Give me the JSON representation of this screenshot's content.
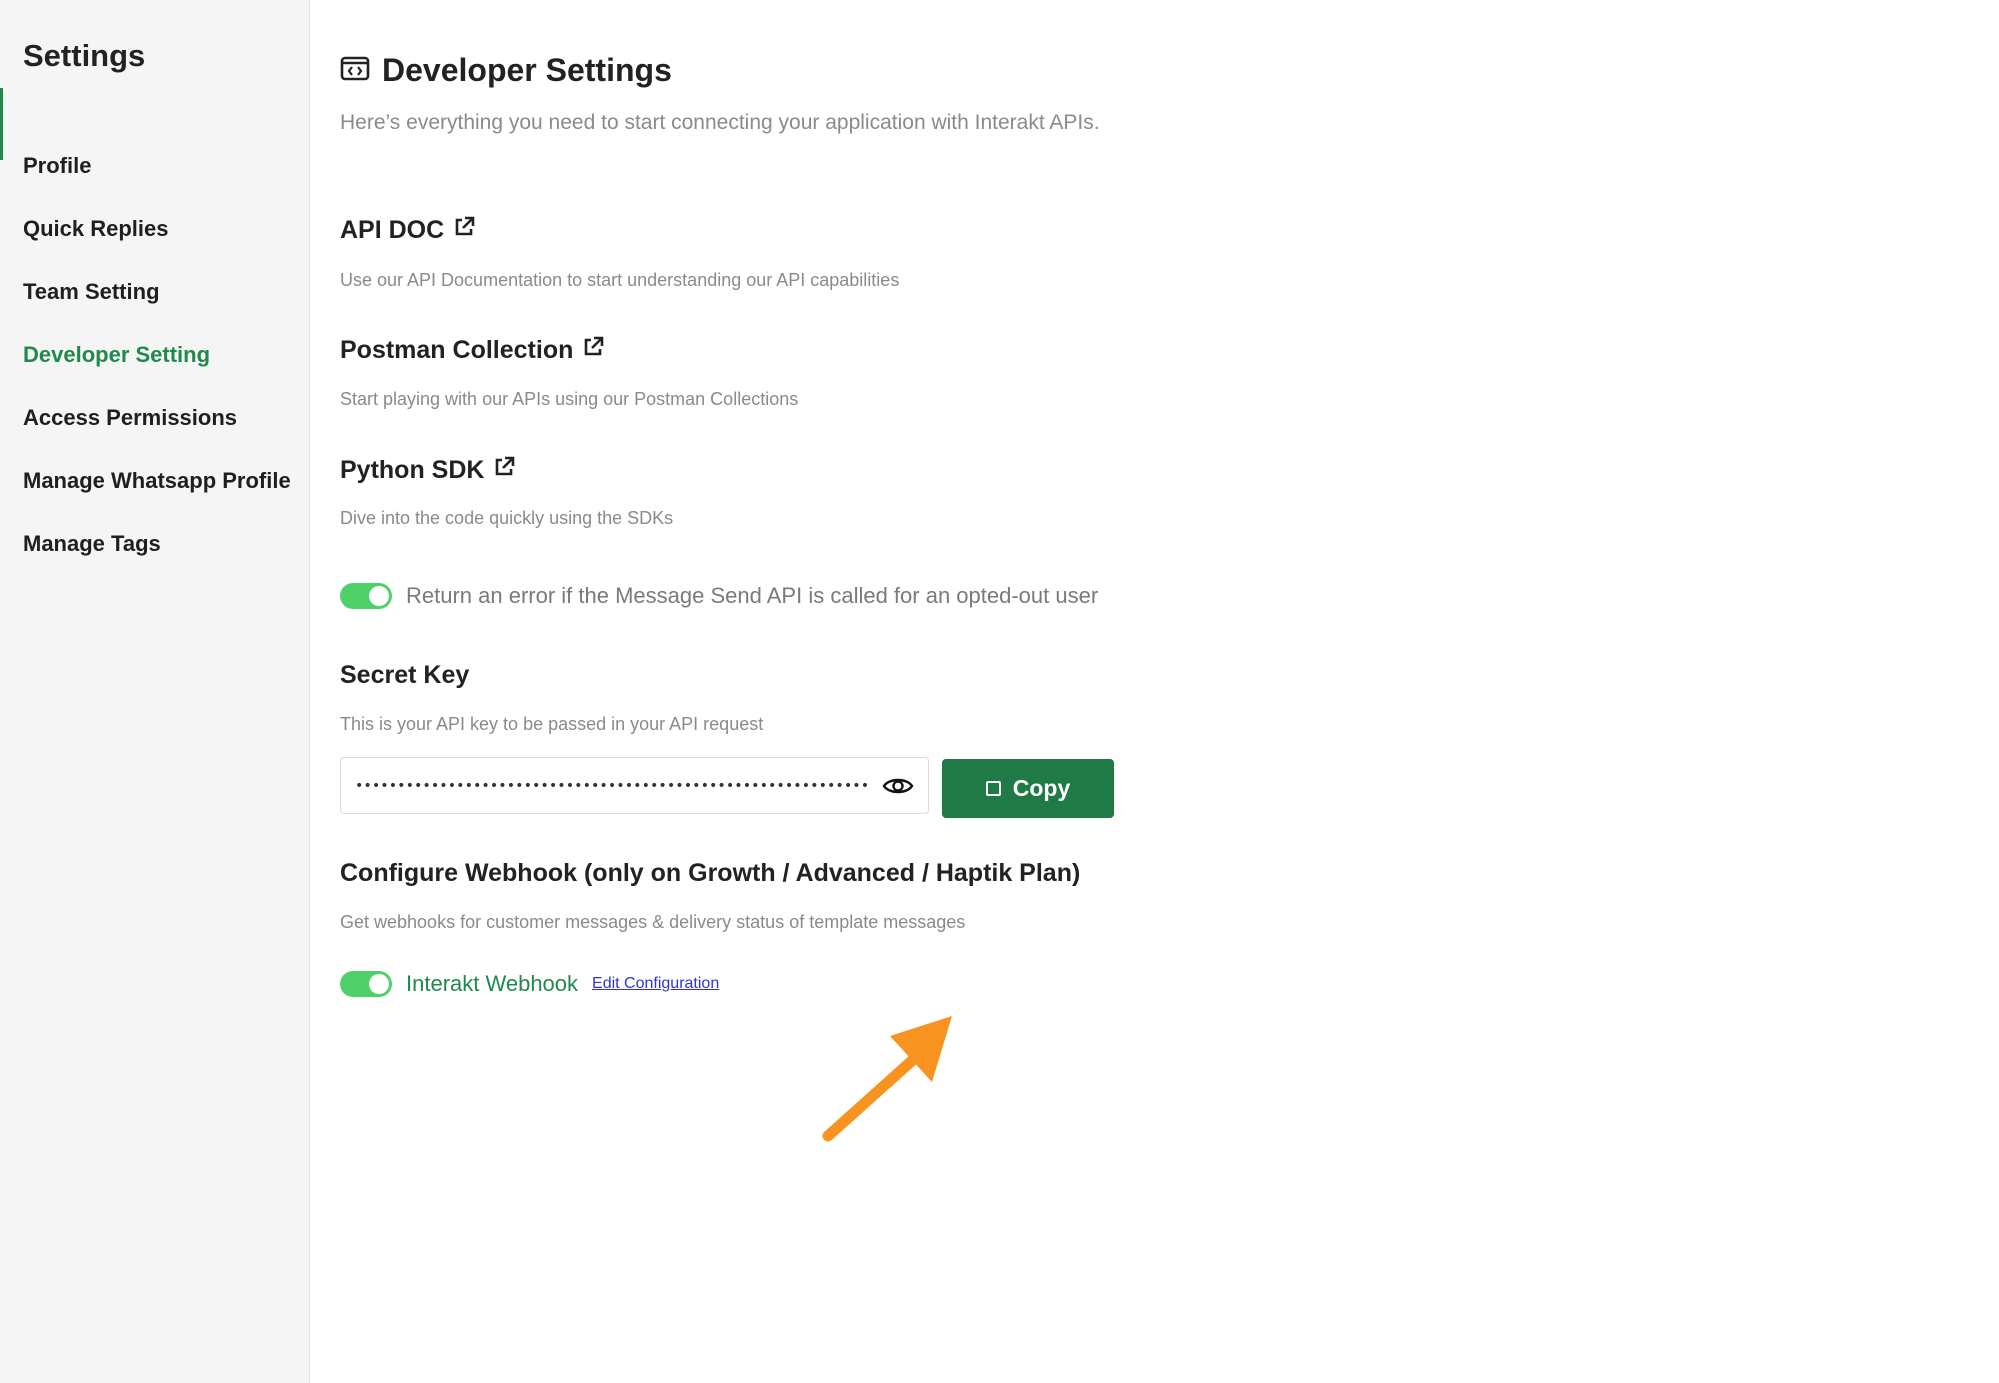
{
  "sidebar": {
    "title": "Settings",
    "items": [
      {
        "label": "Profile"
      },
      {
        "label": "Quick Replies"
      },
      {
        "label": "Team Setting"
      },
      {
        "label": "Developer Setting"
      },
      {
        "label": "Access Permissions"
      },
      {
        "label": "Manage Whatsapp Profile"
      },
      {
        "label": "Manage Tags"
      }
    ],
    "active_item": "Developer Setting"
  },
  "header": {
    "title": "Developer Settings",
    "subtitle": "Here’s everything you need to start connecting your application with Interakt APIs."
  },
  "sections": {
    "api_doc": {
      "title": "API DOC",
      "description": "Use our API Documentation to start understanding our API capabilities"
    },
    "postman": {
      "title": "Postman Collection",
      "description": "Start playing with our APIs using our Postman Collections"
    },
    "python_sdk": {
      "title": "Python SDK",
      "description": "Dive into the code quickly using the SDKs"
    },
    "opt_out_toggle": {
      "label": "Return an error if the Message Send API is called for an opted-out user",
      "enabled": true
    },
    "secret_key": {
      "title": "Secret Key",
      "description": "This is your API key to be passed in your API request",
      "masked_value": "•••••••••••••••••••••••••••••••••••••••••••••••••••••••••••••",
      "copy_label": "Copy"
    },
    "webhook": {
      "title": "Configure Webhook (only on Growth / Advanced / Haptik Plan)",
      "description": "Get webhooks for customer messages & delivery status of template messages",
      "toggle_label": "Interakt Webhook",
      "enabled": true,
      "edit_link": "Edit Configuration"
    }
  },
  "colors": {
    "accent_green": "#1f8a4c",
    "button_green": "#1f7a46",
    "toggle_green": "#4fd16a",
    "annotation_arrow": "#f7931e"
  },
  "icons": {
    "title_icon": "code-window-icon",
    "external_link": "external-link-icon",
    "reveal": "eye-icon",
    "copy": "copy-icon"
  }
}
